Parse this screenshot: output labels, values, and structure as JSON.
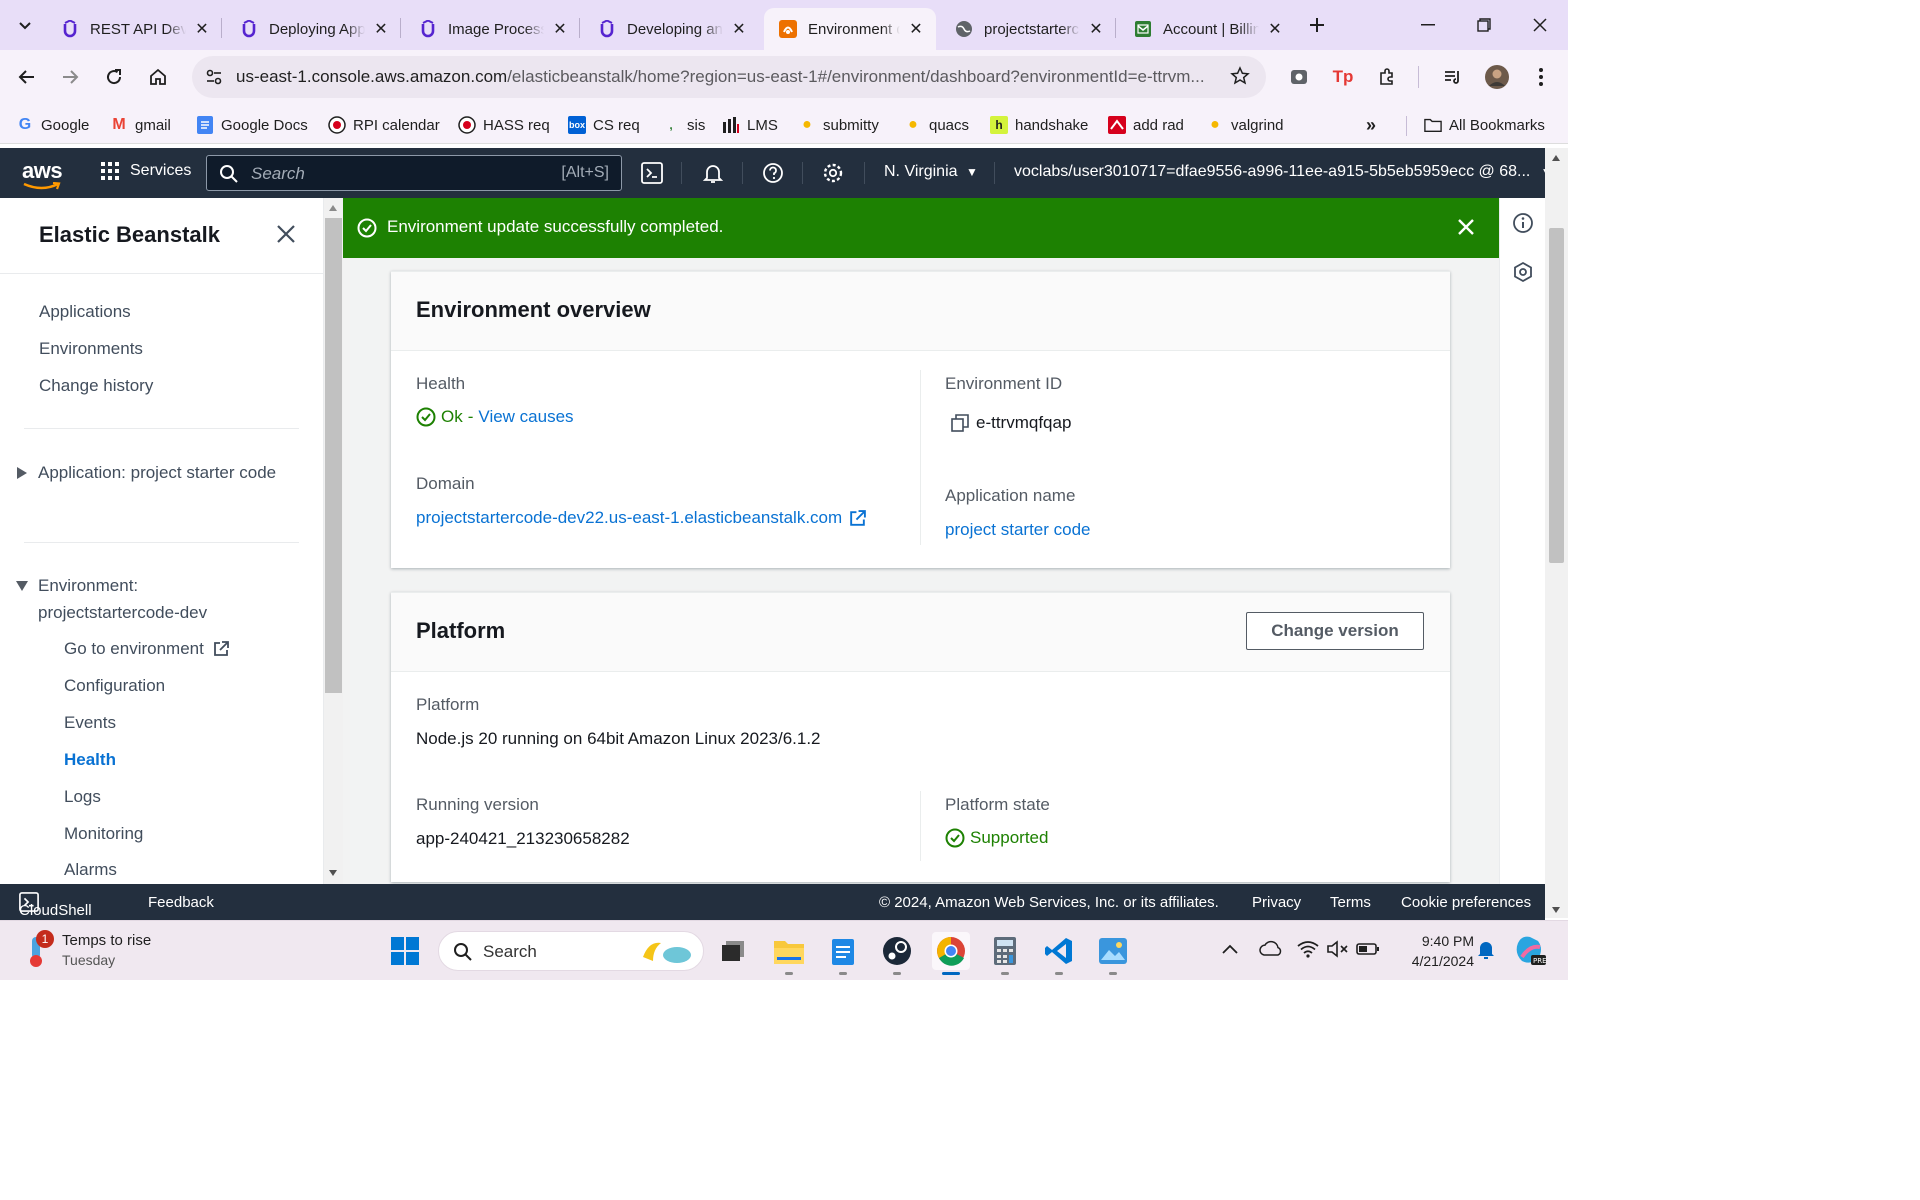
{
  "browser": {
    "tabs": [
      {
        "label": "REST API Development",
        "icon": "udemy-icon",
        "active": false
      },
      {
        "label": "Deploying Applications",
        "icon": "udemy-icon",
        "active": false
      },
      {
        "label": "Image Processing",
        "icon": "udemy-icon",
        "active": false
      },
      {
        "label": "Developing and Deploying",
        "icon": "udemy-icon",
        "active": false
      },
      {
        "label": "Environment details",
        "icon": "beanstalk-icon",
        "active": true
      },
      {
        "label": "projectstartercode",
        "icon": "globe-icon",
        "active": false
      },
      {
        "label": "Account | Billing",
        "icon": "account-icon",
        "active": false
      }
    ],
    "url_host": "us-east-1.console.aws.amazon.com",
    "url_path": "/elasticbeanstalk/home?region=us-east-1#/environment/dashboard?environmentId=e-ttrvm...",
    "bookmarks": [
      "Google",
      "gmail",
      "Google Docs",
      "RPI calendar",
      "HASS req",
      "CS req",
      "sis",
      "LMS",
      "submitty",
      "quacs",
      "handshake",
      "add rad",
      "valgrind"
    ],
    "all_bookmarks": "All Bookmarks"
  },
  "aws": {
    "logo": "aws",
    "services": "Services",
    "search_placeholder": "Search",
    "search_shortcut": "[Alt+S]",
    "region": "N. Virginia",
    "account": "voclabs/user3010717=dfae9556-a996-11ee-a915-5b5eb5959ecc @ 68..."
  },
  "sidenav": {
    "title": "Elastic Beanstalk",
    "top_items": [
      "Applications",
      "Environments",
      "Change history"
    ],
    "application_section": "Application: project starter code",
    "environment_section": "Environment: projectstartercode-dev",
    "env_items": [
      "Go to environment",
      "Configuration",
      "Events",
      "Health",
      "Logs",
      "Monitoring",
      "Alarms"
    ],
    "active_item": "Health"
  },
  "flash": {
    "message": "Environment update successfully completed.",
    "color": "#1d8102"
  },
  "overview": {
    "title": "Environment overview",
    "health_label": "Health",
    "health_value": "Ok",
    "health_link": "View causes",
    "env_id_label": "Environment ID",
    "env_id": "e-ttrvmqfqap",
    "domain_label": "Domain",
    "domain": "projectstartercode-dev22.us-east-1.elasticbeanstalk.com",
    "app_name_label": "Application name",
    "app_name": "project starter code"
  },
  "platform": {
    "title": "Platform",
    "change_version": "Change version",
    "platform_label": "Platform",
    "platform_value": "Node.js 20 running on 64bit Amazon Linux 2023/6.1.2",
    "running_version_label": "Running version",
    "running_version": "app-240421_213230658282",
    "state_label": "Platform state",
    "state_value": "Supported"
  },
  "footer": {
    "cloudshell": "CloudShell",
    "feedback": "Feedback",
    "copyright": "© 2024, Amazon Web Services, Inc. or its affiliates.",
    "privacy": "Privacy",
    "terms": "Terms",
    "cookies": "Cookie preferences"
  },
  "taskbar": {
    "weather_title": "Temps to rise",
    "weather_sub": "Tuesday",
    "weather_badge": "1",
    "search": "Search",
    "time": "9:40 PM",
    "date": "4/21/2024"
  },
  "colors": {
    "aws_nav": "#232f3e",
    "link": "#0972d3",
    "success": "#1d8102"
  }
}
